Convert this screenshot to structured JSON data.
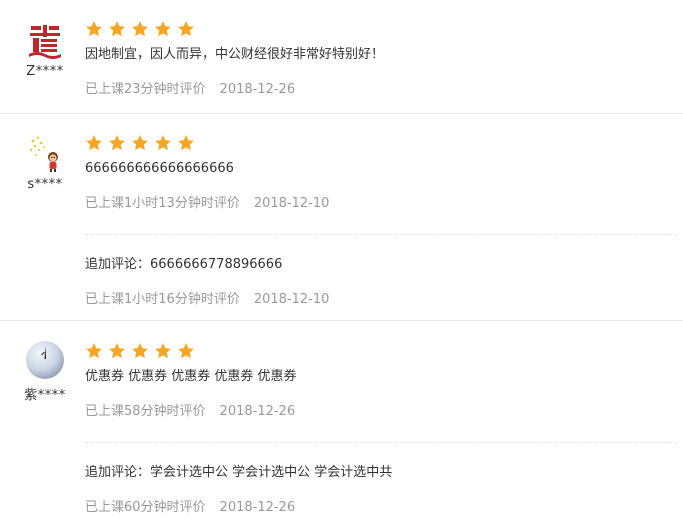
{
  "reviews": [
    {
      "username": "Z****",
      "avatar_icon": "red-seal-logo-icon",
      "rating": 5,
      "text": "因地制宜，因人而异，中公财经很好非常好特别好！",
      "meta": "已上课23分钟时评价",
      "date": "2018-12-26"
    },
    {
      "username": "s****",
      "avatar_icon": "cartoon-character-icon",
      "rating": 5,
      "text": "666666666666666666",
      "meta": "已上课1小时13分钟时评价",
      "date": "2018-12-10",
      "followup": {
        "text": "追加评论：6666666778896666",
        "meta": "已上课1小时16分钟时评价",
        "date": "2018-12-10"
      }
    },
    {
      "username": "紫****",
      "avatar_icon": "moon-avatar-icon",
      "rating": 5,
      "text": "优惠券 优惠券 优惠券 优惠券 优惠券",
      "meta": "已上课58分钟时评价",
      "date": "2018-12-26",
      "followup": {
        "text": "追加评论：学会计选中公 学会计选中公 学会计选中共",
        "meta": "已上课60分钟时评价",
        "date": "2018-12-26"
      }
    }
  ],
  "colors": {
    "star": "#f5a623",
    "meta_text": "#999999",
    "body_text": "#333333",
    "seal_red": "#c0272d"
  }
}
